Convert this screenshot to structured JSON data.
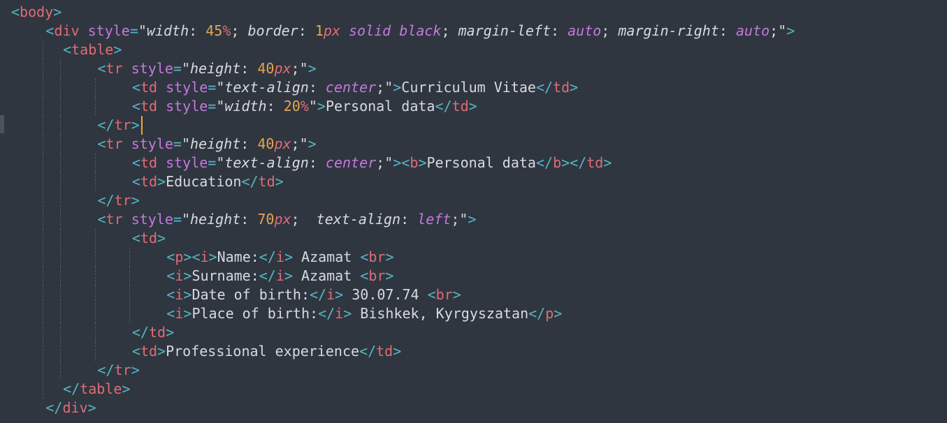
{
  "lines": [
    {
      "indent": 0,
      "tokens": [
        [
          "punc",
          "<"
        ],
        [
          "tag",
          "body"
        ],
        [
          "punc",
          ">"
        ]
      ]
    },
    {
      "indent": 2,
      "tokens": [
        [
          "punc",
          "<"
        ],
        [
          "tag",
          "div"
        ],
        [
          "text",
          " "
        ],
        [
          "attr",
          "style"
        ],
        [
          "punc",
          "="
        ],
        [
          "str",
          "\""
        ],
        [
          "prop",
          "width"
        ],
        [
          "text",
          ": "
        ],
        [
          "num",
          "45"
        ],
        [
          "unit",
          "%"
        ],
        [
          "text",
          "; "
        ],
        [
          "prop",
          "border"
        ],
        [
          "text",
          ": "
        ],
        [
          "num",
          "1"
        ],
        [
          "unit",
          "px"
        ],
        [
          "text",
          " "
        ],
        [
          "kw",
          "solid"
        ],
        [
          "text",
          " "
        ],
        [
          "kw",
          "black"
        ],
        [
          "text",
          "; "
        ],
        [
          "prop",
          "margin-left"
        ],
        [
          "text",
          ": "
        ],
        [
          "kw",
          "auto"
        ],
        [
          "text",
          "; "
        ],
        [
          "prop",
          "margin-right"
        ],
        [
          "text",
          ": "
        ],
        [
          "kw",
          "auto"
        ],
        [
          "text",
          ";"
        ],
        [
          "str",
          "\""
        ],
        [
          "punc",
          ">"
        ]
      ]
    },
    {
      "indent": 3,
      "tokens": [
        [
          "punc",
          "<"
        ],
        [
          "tag",
          "table"
        ],
        [
          "punc",
          ">"
        ]
      ]
    },
    {
      "indent": 5,
      "tokens": [
        [
          "punc",
          "<"
        ],
        [
          "tag",
          "tr"
        ],
        [
          "text",
          " "
        ],
        [
          "attr",
          "style"
        ],
        [
          "punc",
          "="
        ],
        [
          "str",
          "\""
        ],
        [
          "prop",
          "height"
        ],
        [
          "text",
          ": "
        ],
        [
          "num",
          "40"
        ],
        [
          "unit",
          "px"
        ],
        [
          "text",
          ";"
        ],
        [
          "str",
          "\""
        ],
        [
          "punc",
          ">"
        ]
      ]
    },
    {
      "indent": 7,
      "tokens": [
        [
          "punc",
          "<"
        ],
        [
          "tag",
          "td"
        ],
        [
          "text",
          " "
        ],
        [
          "attr",
          "style"
        ],
        [
          "punc",
          "="
        ],
        [
          "str",
          "\""
        ],
        [
          "prop",
          "text-align"
        ],
        [
          "text",
          ": "
        ],
        [
          "kw",
          "center"
        ],
        [
          "text",
          ";"
        ],
        [
          "str",
          "\""
        ],
        [
          "punc",
          ">"
        ],
        [
          "text",
          "Curriculum Vitae"
        ],
        [
          "punc",
          "</"
        ],
        [
          "tag",
          "td"
        ],
        [
          "punc",
          ">"
        ]
      ]
    },
    {
      "indent": 7,
      "tokens": [
        [
          "punc",
          "<"
        ],
        [
          "tag",
          "td"
        ],
        [
          "text",
          " "
        ],
        [
          "attr",
          "style"
        ],
        [
          "punc",
          "="
        ],
        [
          "str",
          "\""
        ],
        [
          "prop",
          "width"
        ],
        [
          "text",
          ": "
        ],
        [
          "num",
          "20"
        ],
        [
          "unit",
          "%"
        ],
        [
          "str",
          "\""
        ],
        [
          "punc",
          ">"
        ],
        [
          "text",
          "Personal data"
        ],
        [
          "punc",
          "</"
        ],
        [
          "tag",
          "td"
        ],
        [
          "punc",
          ">"
        ]
      ]
    },
    {
      "indent": 5,
      "tokens": [
        [
          "punc",
          "</"
        ],
        [
          "tag",
          "tr"
        ],
        [
          "punc",
          ">"
        ]
      ]
    },
    {
      "indent": 5,
      "tokens": [
        [
          "punc",
          "<"
        ],
        [
          "tag",
          "tr"
        ],
        [
          "text",
          " "
        ],
        [
          "attr",
          "style"
        ],
        [
          "punc",
          "="
        ],
        [
          "str",
          "\""
        ],
        [
          "prop",
          "height"
        ],
        [
          "text",
          ": "
        ],
        [
          "num",
          "40"
        ],
        [
          "unit",
          "px"
        ],
        [
          "text",
          ";"
        ],
        [
          "str",
          "\""
        ],
        [
          "punc",
          ">"
        ]
      ]
    },
    {
      "indent": 7,
      "tokens": [
        [
          "punc",
          "<"
        ],
        [
          "tag",
          "td"
        ],
        [
          "text",
          " "
        ],
        [
          "attr",
          "style"
        ],
        [
          "punc",
          "="
        ],
        [
          "str",
          "\""
        ],
        [
          "prop",
          "text-align"
        ],
        [
          "text",
          ": "
        ],
        [
          "kw",
          "center"
        ],
        [
          "text",
          ";"
        ],
        [
          "str",
          "\""
        ],
        [
          "punc",
          ">"
        ],
        [
          "punc",
          "<"
        ],
        [
          "tag",
          "b"
        ],
        [
          "punc",
          ">"
        ],
        [
          "text",
          "Personal data"
        ],
        [
          "punc",
          "</"
        ],
        [
          "tag",
          "b"
        ],
        [
          "punc",
          ">"
        ],
        [
          "punc",
          "</"
        ],
        [
          "tag",
          "td"
        ],
        [
          "punc",
          ">"
        ]
      ]
    },
    {
      "indent": 7,
      "tokens": [
        [
          "punc",
          "<"
        ],
        [
          "tag",
          "td"
        ],
        [
          "punc",
          ">"
        ],
        [
          "text",
          "Education"
        ],
        [
          "punc",
          "</"
        ],
        [
          "tag",
          "td"
        ],
        [
          "punc",
          ">"
        ]
      ]
    },
    {
      "indent": 5,
      "tokens": [
        [
          "punc",
          "</"
        ],
        [
          "tag",
          "tr"
        ],
        [
          "punc",
          ">"
        ]
      ]
    },
    {
      "indent": 5,
      "tokens": [
        [
          "punc",
          "<"
        ],
        [
          "tag",
          "tr"
        ],
        [
          "text",
          " "
        ],
        [
          "attr",
          "style"
        ],
        [
          "punc",
          "="
        ],
        [
          "str",
          "\""
        ],
        [
          "prop",
          "height"
        ],
        [
          "text",
          ": "
        ],
        [
          "num",
          "70"
        ],
        [
          "unit",
          "px"
        ],
        [
          "text",
          ";  "
        ],
        [
          "prop",
          "text-align"
        ],
        [
          "text",
          ": "
        ],
        [
          "kw",
          "left"
        ],
        [
          "text",
          ";"
        ],
        [
          "str",
          "\""
        ],
        [
          "punc",
          ">"
        ]
      ]
    },
    {
      "indent": 7,
      "tokens": [
        [
          "punc",
          "<"
        ],
        [
          "tag",
          "td"
        ],
        [
          "punc",
          ">"
        ]
      ]
    },
    {
      "indent": 9,
      "tokens": [
        [
          "punc",
          "<"
        ],
        [
          "tag",
          "p"
        ],
        [
          "punc",
          ">"
        ],
        [
          "punc",
          "<"
        ],
        [
          "tag",
          "i"
        ],
        [
          "punc",
          ">"
        ],
        [
          "text",
          "Name:"
        ],
        [
          "punc",
          "</"
        ],
        [
          "tag",
          "i"
        ],
        [
          "punc",
          ">"
        ],
        [
          "text",
          " Azamat "
        ],
        [
          "punc",
          "<"
        ],
        [
          "tag",
          "br"
        ],
        [
          "punc",
          ">"
        ]
      ]
    },
    {
      "indent": 9,
      "tokens": [
        [
          "punc",
          "<"
        ],
        [
          "tag",
          "i"
        ],
        [
          "punc",
          ">"
        ],
        [
          "text",
          "Surname:"
        ],
        [
          "punc",
          "</"
        ],
        [
          "tag",
          "i"
        ],
        [
          "punc",
          ">"
        ],
        [
          "text",
          " Azamat "
        ],
        [
          "punc",
          "<"
        ],
        [
          "tag",
          "br"
        ],
        [
          "punc",
          ">"
        ]
      ]
    },
    {
      "indent": 9,
      "tokens": [
        [
          "punc",
          "<"
        ],
        [
          "tag",
          "i"
        ],
        [
          "punc",
          ">"
        ],
        [
          "text",
          "Date of birth:"
        ],
        [
          "punc",
          "</"
        ],
        [
          "tag",
          "i"
        ],
        [
          "punc",
          ">"
        ],
        [
          "text",
          " 30.07.74 "
        ],
        [
          "punc",
          "<"
        ],
        [
          "tag",
          "br"
        ],
        [
          "punc",
          ">"
        ]
      ]
    },
    {
      "indent": 9,
      "tokens": [
        [
          "punc",
          "<"
        ],
        [
          "tag",
          "i"
        ],
        [
          "punc",
          ">"
        ],
        [
          "text",
          "Place of birth:"
        ],
        [
          "punc",
          "</"
        ],
        [
          "tag",
          "i"
        ],
        [
          "punc",
          ">"
        ],
        [
          "text",
          " Bishkek, Kyrgyszatan"
        ],
        [
          "punc",
          "</"
        ],
        [
          "tag",
          "p"
        ],
        [
          "punc",
          ">"
        ]
      ]
    },
    {
      "indent": 7,
      "tokens": [
        [
          "punc",
          "</"
        ],
        [
          "tag",
          "td"
        ],
        [
          "punc",
          ">"
        ]
      ]
    },
    {
      "indent": 7,
      "tokens": [
        [
          "punc",
          "<"
        ],
        [
          "tag",
          "td"
        ],
        [
          "punc",
          ">"
        ],
        [
          "text",
          "Professional experience"
        ],
        [
          "punc",
          "</"
        ],
        [
          "tag",
          "td"
        ],
        [
          "punc",
          ">"
        ]
      ]
    },
    {
      "indent": 5,
      "tokens": [
        [
          "punc",
          "</"
        ],
        [
          "tag",
          "tr"
        ],
        [
          "punc",
          ">"
        ]
      ]
    },
    {
      "indent": 3,
      "tokens": [
        [
          "punc",
          "</"
        ],
        [
          "tag",
          "table"
        ],
        [
          "punc",
          ">"
        ]
      ]
    },
    {
      "indent": 2,
      "tokens": [
        [
          "punc",
          "</"
        ],
        [
          "tag",
          "div"
        ],
        [
          "punc",
          ">"
        ]
      ]
    }
  ],
  "caret_line": 6
}
